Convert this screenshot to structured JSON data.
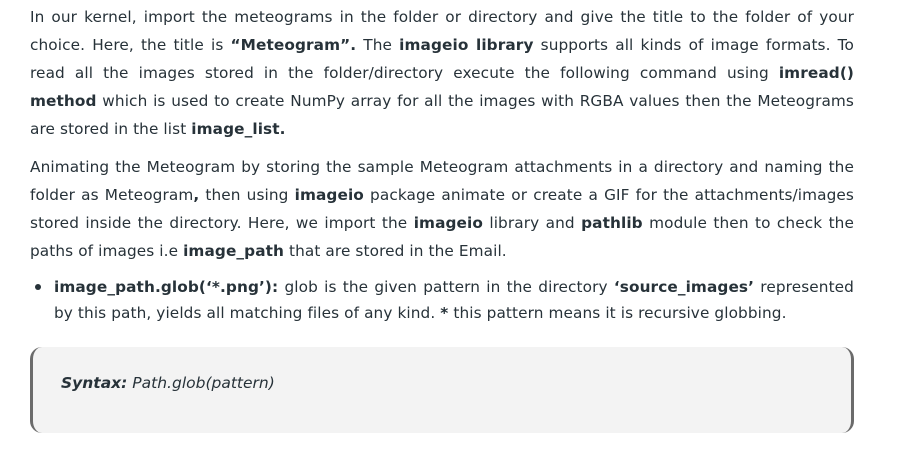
{
  "para1": {
    "t1": "In our kernel, import the meteograms in the folder or directory and give the title to the folder of your choice. Here, the title is ",
    "b1": "“Meteogram”.",
    "t2": " The ",
    "b2": "imageio library",
    "t3": " supports all kinds of image formats. To read all the images stored in the folder/directory execute the following command using ",
    "b3": "imread() method",
    "t4": " which is used to create NumPy array for all the images with RGBA values then the Meteograms are stored in the list ",
    "b4": "image_list."
  },
  "para2": {
    "t1": "Animating the Meteogram by storing the sample Meteogram attachments in a directory and naming the folder as Meteogram",
    "b1": ",",
    "t2": " then using ",
    "b2": "imageio",
    "t3": " package animate or create a GIF for the attachments/images stored inside the directory. Here, we import the ",
    "b3": "imageio",
    "t4": " library and ",
    "b4": "pathlib",
    "t5": " module then to check the paths of images i.e ",
    "b5": "image_path",
    "t6": " that are stored in the Email."
  },
  "bullet1": {
    "b1": "image_path.glob(‘*.png’):",
    "t1": " glob is the given pattern in the directory ",
    "b2": "‘source_images’",
    "t2": " represented by this path, yields all matching files of any kind. ",
    "b3": "*",
    "t3": " this pattern means it is recursive globbing."
  },
  "syntax": {
    "label": "Syntax:",
    "code": " Path.glob(pattern)"
  }
}
